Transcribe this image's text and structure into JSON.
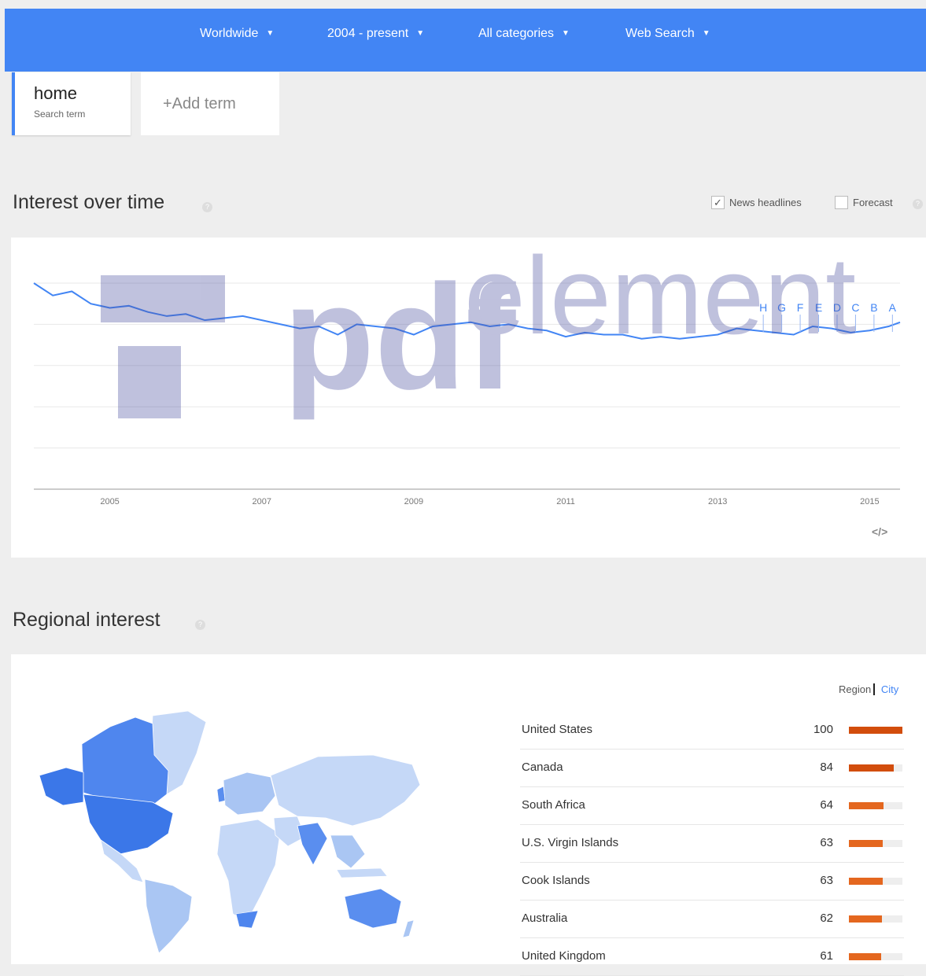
{
  "filters": [
    {
      "label": "Worldwide"
    },
    {
      "label": "2004 - present"
    },
    {
      "label": "All categories"
    },
    {
      "label": "Web Search"
    }
  ],
  "term": {
    "name": "home",
    "subtitle": "Search term"
  },
  "add_term": "+Add term",
  "interest_section": {
    "title": "Interest over time",
    "news_headlines_label": "News headlines",
    "news_headlines_checked": true,
    "forecast_label": "Forecast",
    "forecast_checked": false,
    "embed_label": "</>"
  },
  "chart_data": {
    "type": "line",
    "x_ticks": [
      "2005",
      "2007",
      "2009",
      "2011",
      "2013",
      "2015"
    ],
    "series": [
      {
        "color": "#4285f4",
        "x": [
          2004.0,
          2004.25,
          2004.5,
          2004.75,
          2005.0,
          2005.25,
          2005.5,
          2005.75,
          2006.0,
          2006.25,
          2006.5,
          2006.75,
          2007.0,
          2007.25,
          2007.5,
          2007.75,
          2008.0,
          2008.25,
          2008.5,
          2008.75,
          2009.0,
          2009.25,
          2009.5,
          2009.75,
          2010.0,
          2010.25,
          2010.5,
          2010.75,
          2011.0,
          2011.25,
          2011.5,
          2011.75,
          2012.0,
          2012.25,
          2012.5,
          2012.75,
          2013.0,
          2013.25,
          2013.5,
          2013.75,
          2014.0,
          2014.25,
          2014.5,
          2014.75,
          2015.0,
          2015.25,
          2015.4
        ],
        "values": [
          100,
          94,
          96,
          90,
          88,
          89,
          86,
          84,
          85,
          82,
          83,
          84,
          82,
          80,
          78,
          79,
          75,
          80,
          79,
          78,
          75,
          79,
          80,
          81,
          79,
          80,
          78,
          77,
          74,
          76,
          75,
          75,
          73,
          74,
          73,
          74,
          75,
          78,
          77,
          76,
          75,
          79,
          78,
          76,
          77,
          79,
          81
        ]
      }
    ],
    "annotations": [
      "H",
      "G",
      "F",
      "E",
      "D",
      "C",
      "B",
      "A"
    ],
    "ylim": [
      0,
      100
    ],
    "grid": true
  },
  "regional_section": {
    "title": "Regional interest",
    "toggle_region": "Region",
    "toggle_city": "City",
    "regions": [
      {
        "name": "United States",
        "value": 100,
        "color": "#d24d0c"
      },
      {
        "name": "Canada",
        "value": 84,
        "color": "#d24d0c"
      },
      {
        "name": "South Africa",
        "value": 64,
        "color": "#e4671f"
      },
      {
        "name": "U.S. Virgin Islands",
        "value": 63,
        "color": "#e4671f"
      },
      {
        "name": "Cook Islands",
        "value": 63,
        "color": "#e4671f"
      },
      {
        "name": "Australia",
        "value": 62,
        "color": "#e4671f"
      },
      {
        "name": "United Kingdom",
        "value": 61,
        "color": "#e4671f"
      }
    ]
  },
  "watermark": {
    "text_bold": "pdf",
    "text_light": "element"
  },
  "colors": {
    "brand": "#4285f4",
    "bar_high": "#d24d0c",
    "bar_mid": "#e4671f"
  }
}
